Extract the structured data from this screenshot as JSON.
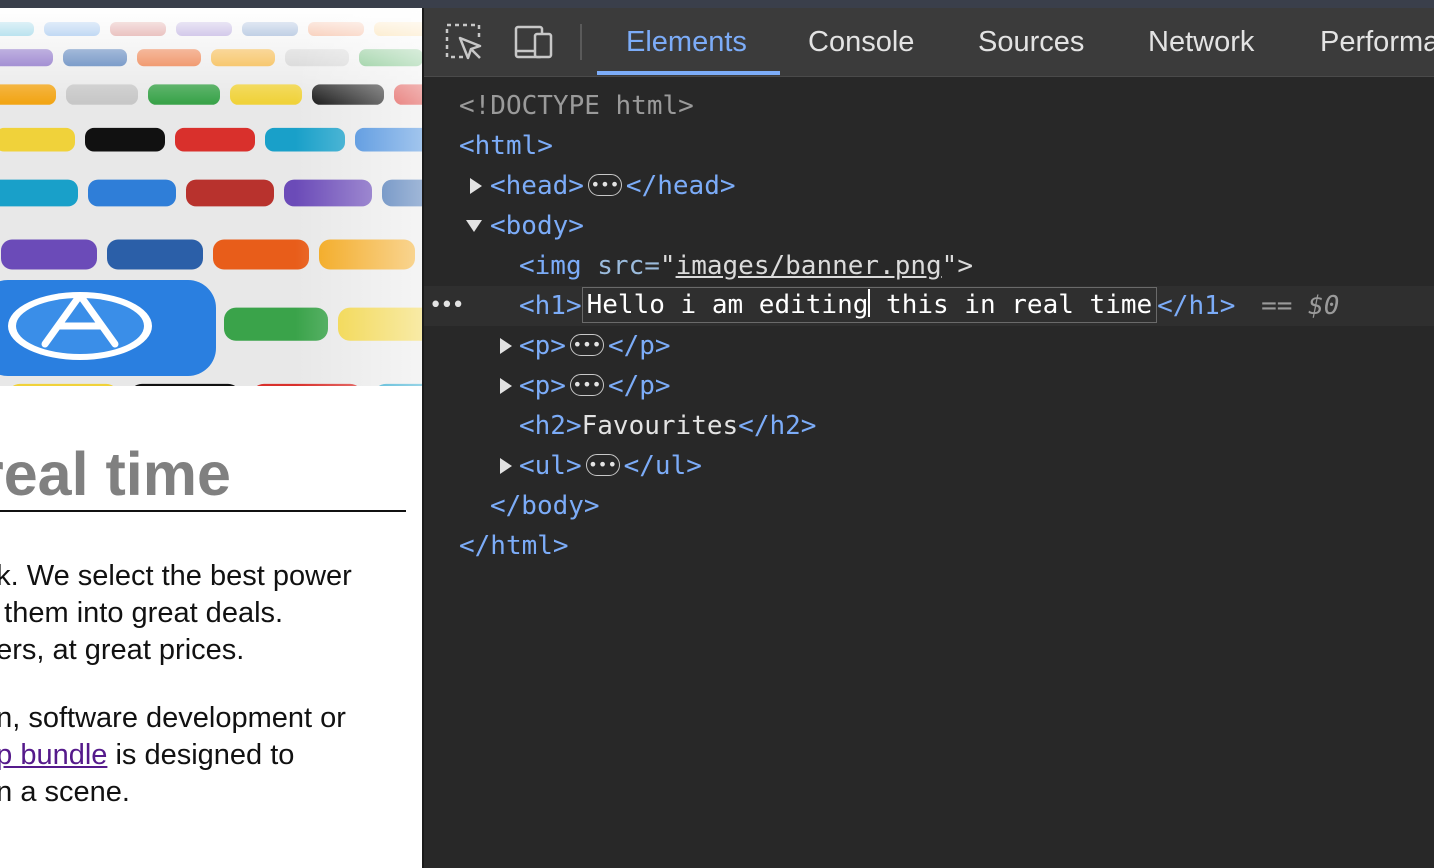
{
  "page": {
    "heading": "real time",
    "paragraph1": [
      "ek. We select the best power",
      "e them into great deals.",
      "hers, at great prices."
    ],
    "paragraph2": {
      "line1": "gn, software development or",
      "line2_link": "pp bundle",
      "line2_rest": " is designed to",
      "line3": "on a scene."
    }
  },
  "devtools": {
    "tabs": [
      "Elements",
      "Console",
      "Sources",
      "Network",
      "Performa"
    ],
    "active_tab": "Elements",
    "tree": {
      "doctype": "<!DOCTYPE html>",
      "html_open": "<html>",
      "head_open": "<head>",
      "head_close": "</head>",
      "body_open": "<body>",
      "img_tag": "<img",
      "img_attr": " src=",
      "img_quote_open": "\"",
      "img_src": "images/banner.png",
      "img_end": "\">",
      "h1_open": "<h1>",
      "h1_text_a": "Hello i am editing",
      "h1_text_b": " this in real time",
      "h1_close": "</h1>",
      "selected_marker": "==",
      "selected_var": "$0",
      "p_open": "<p>",
      "p_close": "</p>",
      "h2_open": "<h2>",
      "h2_text": "Favourites",
      "h2_close": "</h2>",
      "ul_open": "<ul>",
      "ul_close": "</ul>",
      "body_close": "</body>",
      "html_close": "</html>",
      "ellipsis": "•••",
      "row_dots": "•••"
    }
  },
  "colors": {
    "devtools_bg": "#282828",
    "tabbar_bg": "#3b3b3b",
    "accent": "#7cacf8",
    "link": "#551a8b"
  }
}
